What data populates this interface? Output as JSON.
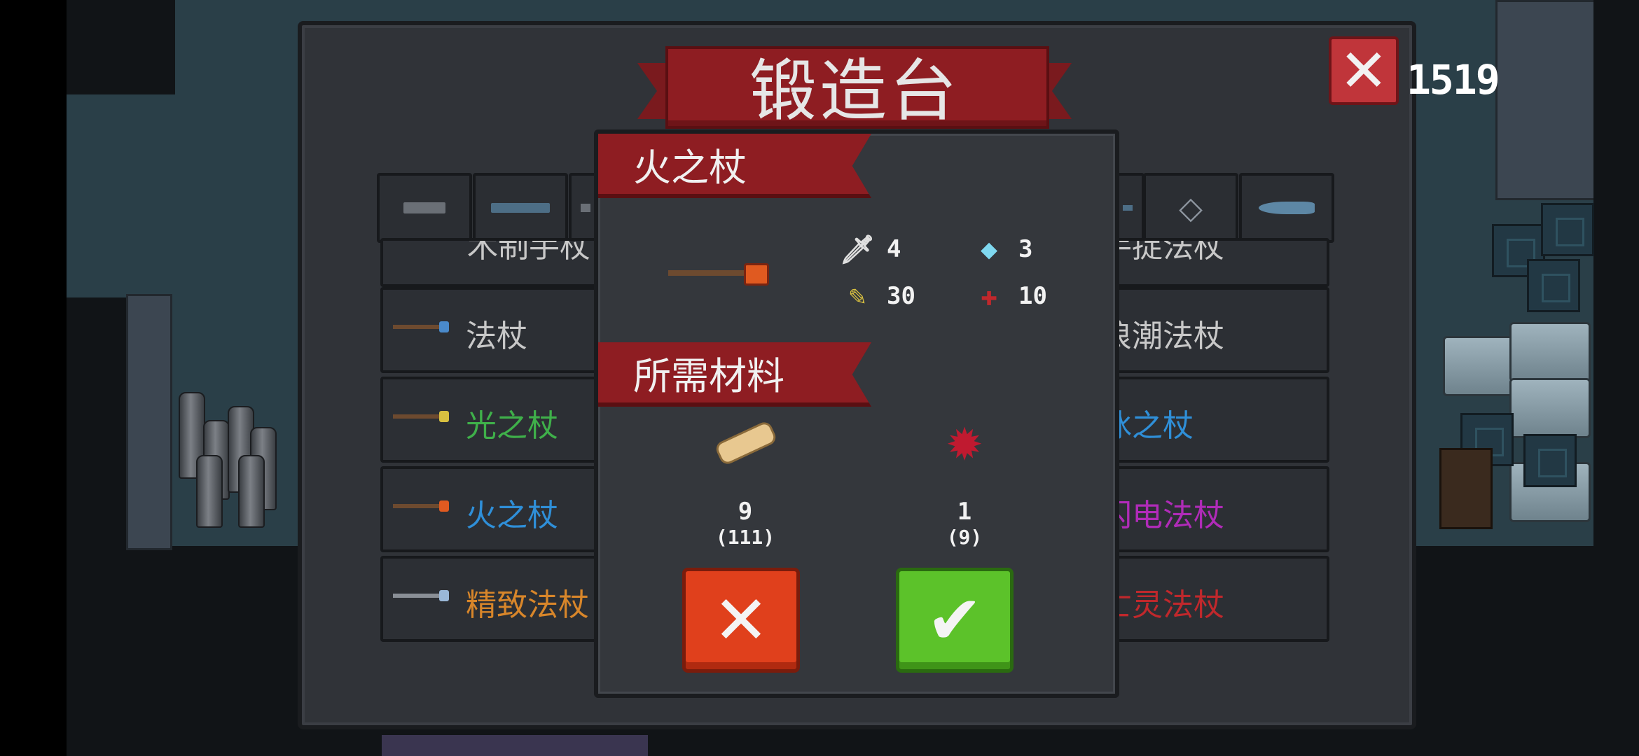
{
  "forge": {
    "title": "锻造台",
    "counter": "1519",
    "tabs": [
      {
        "icon": "pistol-icon"
      },
      {
        "icon": "rifle-icon"
      },
      {
        "icon": "weapon-icon"
      },
      {
        "icon": "staff-icon"
      },
      {
        "icon": "diamond-icon",
        "glyph": "◇"
      },
      {
        "icon": "fish-icon"
      }
    ],
    "list_left": [
      {
        "label": "法杖",
        "color": "#c8c8c8"
      },
      {
        "label": "光之杖",
        "color": "#3fb04a"
      },
      {
        "label": "火之杖",
        "color": "#2f8fd8"
      },
      {
        "label": "精致法杖",
        "color": "#d8862a"
      }
    ],
    "list_right": [
      {
        "label": "浪潮法杖",
        "color": "#c8c8c8"
      },
      {
        "label": "冰之杖",
        "color": "#2f8fd8"
      },
      {
        "label": "闪电法杖",
        "color": "#b02bb8"
      },
      {
        "label": "亡灵法杖",
        "color": "#c0282c"
      }
    ],
    "partial_top_left": "木制手杖",
    "partial_top_right": "冰晶手捉法杖"
  },
  "modal": {
    "item_name": "火之杖",
    "stats": [
      {
        "icon": "sword-icon",
        "value": "4"
      },
      {
        "icon": "crystal-icon",
        "value": "3"
      },
      {
        "icon": "bullet-icon",
        "value": "30"
      },
      {
        "icon": "crosshair-icon",
        "value": "10"
      }
    ],
    "materials_title": "所需材料",
    "materials": [
      {
        "icon": "wood-log-icon",
        "required": "9",
        "owned": "(111)"
      },
      {
        "icon": "red-leaf-icon",
        "required": "1",
        "owned": "(9)"
      }
    ],
    "cancel_glyph": "✕",
    "confirm_glyph": "✔",
    "colors": {
      "cancel": "#e0401c",
      "confirm": "#5cc22a"
    }
  }
}
